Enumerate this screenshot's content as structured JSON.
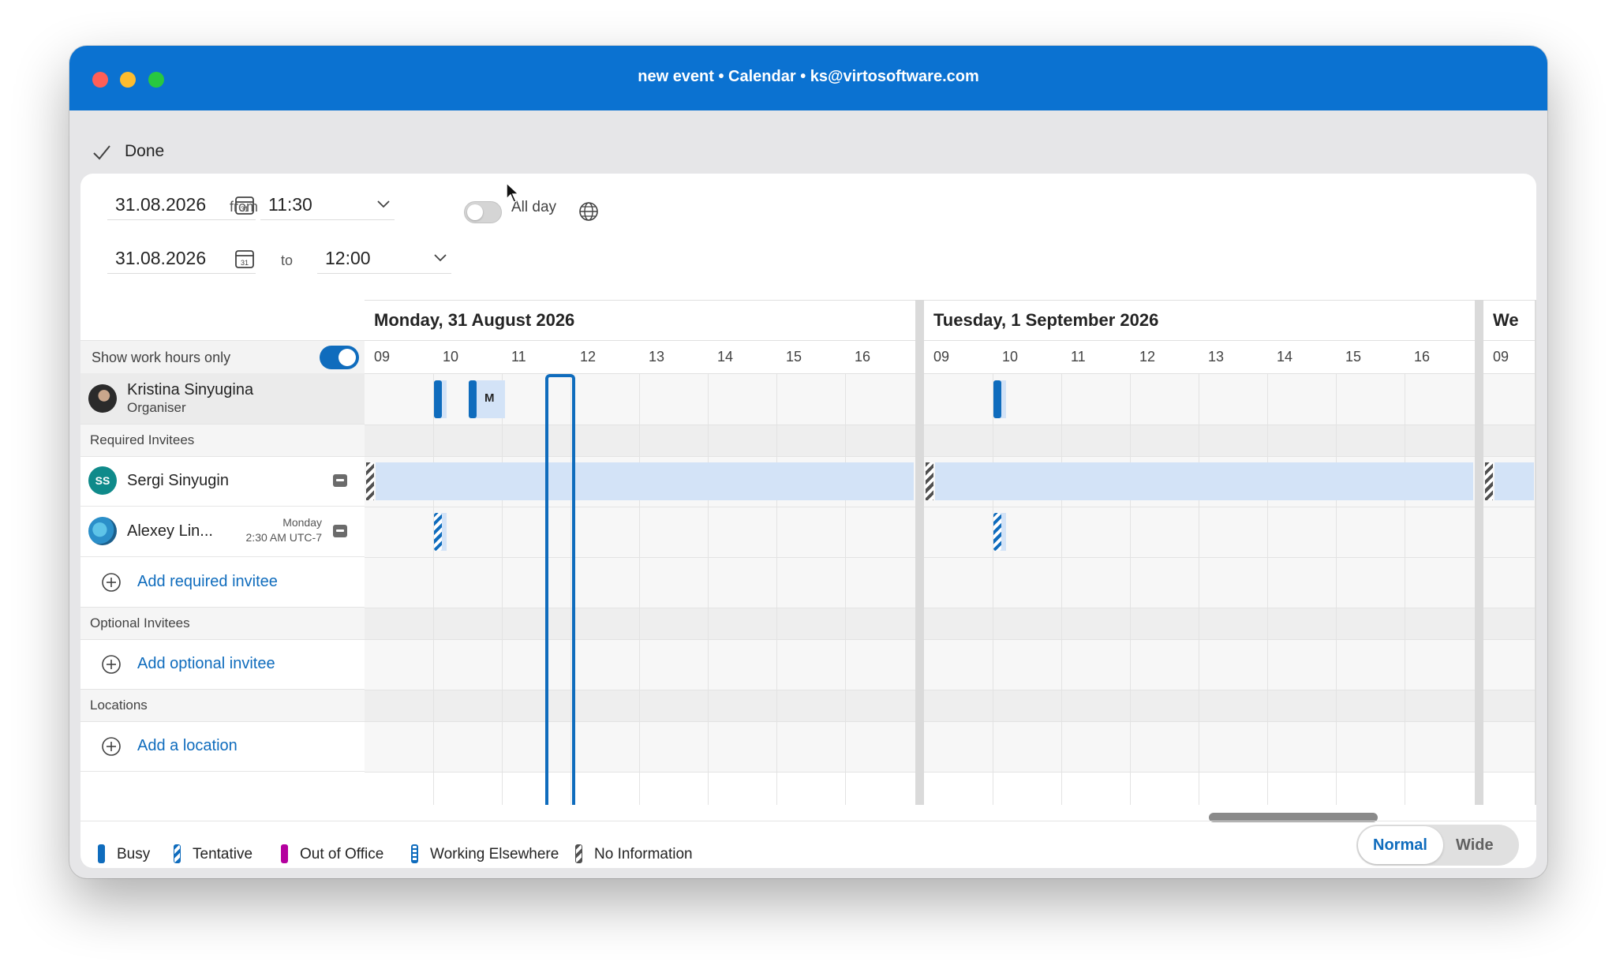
{
  "window": {
    "title": "new event • Calendar • ks@virtosoftware.com"
  },
  "toolbar": {
    "done_label": "Done"
  },
  "datetime": {
    "start_date": "31.08.2026",
    "from_label": "from",
    "start_time": "11:30",
    "end_date": "31.08.2026",
    "to_label": "to",
    "end_time": "12:00",
    "all_day_label": "All day",
    "all_day_on": false,
    "calendar_icon_day": "31"
  },
  "scheduler": {
    "work_hours_label": "Show work hours only",
    "work_hours_on": true,
    "days": [
      {
        "label": "Monday, 31 August 2026",
        "hours": [
          "09",
          "10",
          "11",
          "12",
          "13",
          "14",
          "15",
          "16"
        ]
      },
      {
        "label": "Tuesday, 1 September 2026",
        "hours": [
          "09",
          "10",
          "11",
          "12",
          "13",
          "14",
          "15",
          "16"
        ]
      },
      {
        "label": "We",
        "hours": [
          "09"
        ]
      }
    ],
    "organiser": {
      "name": "Kristina Sinyugina",
      "role": "Organiser",
      "event_letter": "M"
    },
    "required_header": "Required Invitees",
    "invitees": [
      {
        "name": "Sergi Sinyugin",
        "initials": "SS"
      },
      {
        "name": "Alexey Lin...",
        "day": "Monday",
        "time": "2:30 AM UTC-7"
      }
    ],
    "add_required": "Add required invitee",
    "optional_header": "Optional Invitees",
    "add_optional": "Add optional invitee",
    "locations_header": "Locations",
    "add_location": "Add a location"
  },
  "legend": [
    {
      "label": "Busy",
      "icon": "busy-swatch"
    },
    {
      "label": "Tentative",
      "icon": "tentative-swatch"
    },
    {
      "label": "Out of Office",
      "icon": "out-of-office-swatch"
    },
    {
      "label": "Working Elsewhere",
      "icon": "working-elsewhere-swatch"
    },
    {
      "label": "No Information",
      "icon": "no-information-swatch"
    }
  ],
  "view_toggle": {
    "normal": "Normal",
    "wide": "Wide",
    "selected": "Normal"
  },
  "colors": {
    "accent": "#0f6cbd",
    "titlebar": "#0b72d1",
    "out_of_office": "#b4009e",
    "free_band": "#d3e3f7"
  }
}
